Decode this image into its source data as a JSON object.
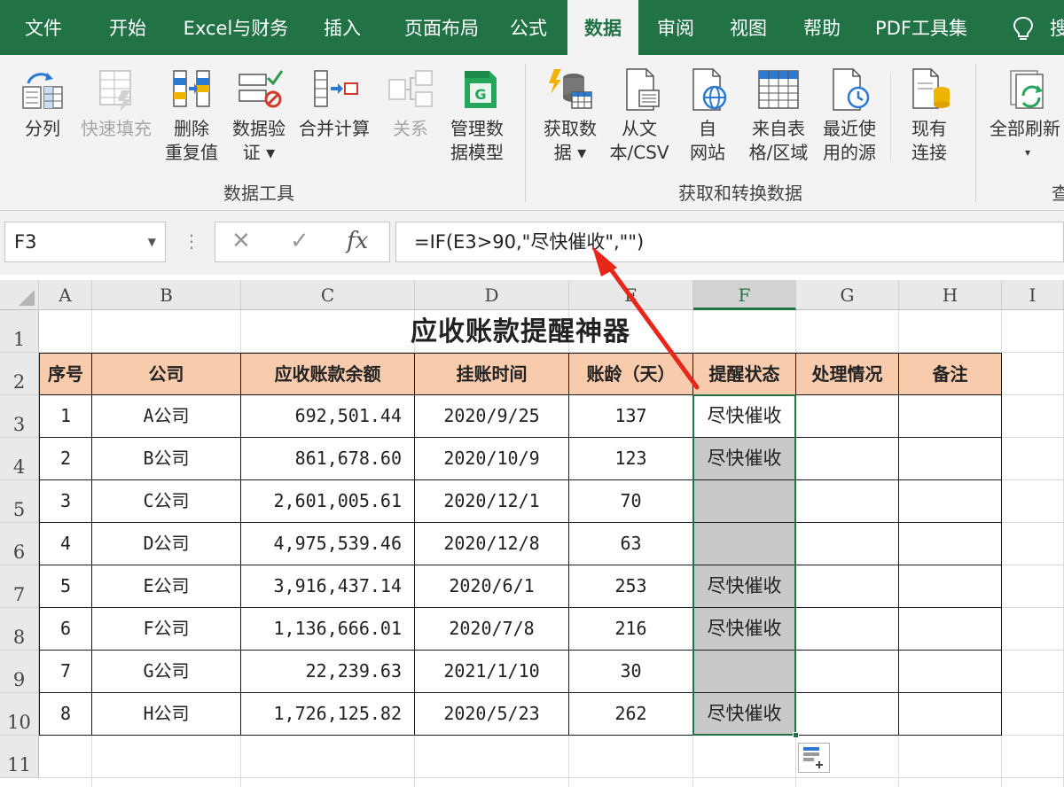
{
  "tabs": [
    {
      "label": "文件"
    },
    {
      "label": "开始"
    },
    {
      "label": "Excel与财务"
    },
    {
      "label": "插入"
    },
    {
      "label": "页面布局"
    },
    {
      "label": "公式"
    },
    {
      "label": "数据"
    },
    {
      "label": "审阅"
    },
    {
      "label": "视图"
    },
    {
      "label": "帮助"
    },
    {
      "label": "PDF工具集"
    }
  ],
  "tab_cut": "搜",
  "ribbon": {
    "buttons": [
      {
        "l1": "分列",
        "l2": ""
      },
      {
        "l1": "快速填充",
        "l2": ""
      },
      {
        "l1": "删除",
        "l2": "重复值"
      },
      {
        "l1": "数据验",
        "l2": "证 ▾"
      },
      {
        "l1": "合并计算",
        "l2": ""
      },
      {
        "l1": "关系",
        "l2": ""
      },
      {
        "l1": "管理数",
        "l2": "据模型"
      },
      {
        "l1": "获取数",
        "l2": "据 ▾"
      },
      {
        "l1": "从文",
        "l2": "本/CSV"
      },
      {
        "l1": "自",
        "l2": "网站"
      },
      {
        "l1": "来自表",
        "l2": "格/区域"
      },
      {
        "l1": "最近使",
        "l2": "用的源"
      },
      {
        "l1": "现有",
        "l2": "连接"
      },
      {
        "l1": "全部刷新",
        "l2": "▾"
      }
    ],
    "groups": [
      {
        "label": "数据工具"
      },
      {
        "label": "获取和转换数据"
      },
      {
        "label": "查"
      }
    ]
  },
  "formula_bar": {
    "name_box": "F3",
    "dots": "⋮",
    "cancel": "✕",
    "enter": "✓",
    "fx": "fx",
    "formula": "=IF(E3>90,\"尽快催收\",\"\")"
  },
  "columns": [
    "A",
    "B",
    "C",
    "D",
    "E",
    "F",
    "G",
    "H",
    "I"
  ],
  "rows": [
    "1",
    "2",
    "3",
    "4",
    "5",
    "6",
    "7",
    "8",
    "9",
    "10",
    "11"
  ],
  "sheet": {
    "title": "应收账款提醒神器",
    "headers": [
      "序号",
      "公司",
      "应收账款余额",
      "挂账时间",
      "账龄（天）",
      "提醒状态",
      "处理情况",
      "备注"
    ],
    "data": [
      [
        "1",
        "A公司",
        "692,501.44",
        "2020/9/25",
        "137",
        "尽快催收",
        "",
        ""
      ],
      [
        "2",
        "B公司",
        "861,678.60",
        "2020/10/9",
        "123",
        "尽快催收",
        "",
        ""
      ],
      [
        "3",
        "C公司",
        "2,601,005.61",
        "2020/12/1",
        "70",
        "",
        "",
        ""
      ],
      [
        "4",
        "D公司",
        "4,975,539.46",
        "2020/12/8",
        "63",
        "",
        "",
        ""
      ],
      [
        "5",
        "E公司",
        "3,916,437.14",
        "2020/6/1",
        "253",
        "尽快催收",
        "",
        ""
      ],
      [
        "6",
        "F公司",
        "1,136,666.01",
        "2020/7/8",
        "216",
        "尽快催收",
        "",
        ""
      ],
      [
        "7",
        "G公司",
        "22,239.63",
        "2021/1/10",
        "30",
        "",
        "",
        ""
      ],
      [
        "8",
        "H公司",
        "1,726,125.82",
        "2020/5/23",
        "262",
        "尽快催收",
        "",
        ""
      ]
    ]
  },
  "colors": {
    "excel_green": "#217346",
    "header_fill": "#f8cbad",
    "selection_fill": "#c9c9c9",
    "annotation_arrow": "#e8261a"
  }
}
